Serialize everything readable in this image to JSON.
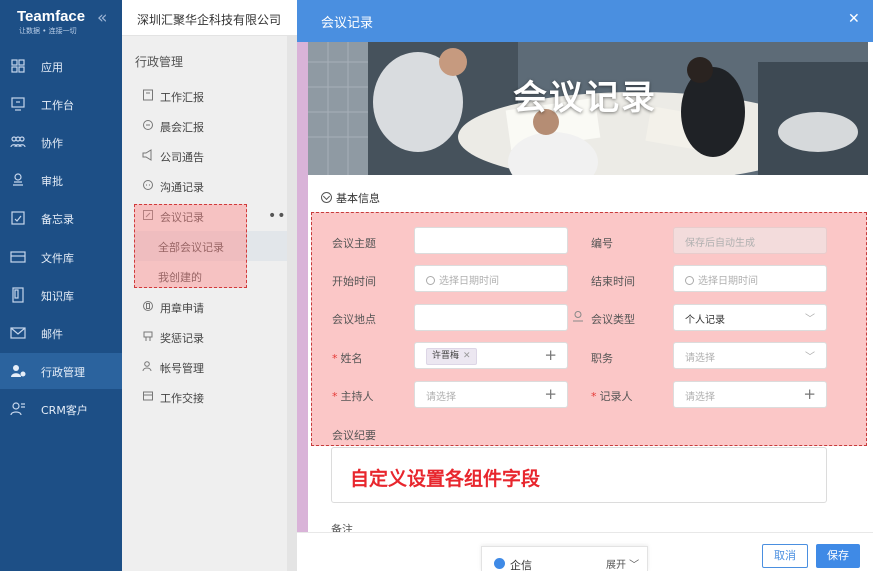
{
  "brand": {
    "name": "Teamface",
    "slogan": "让数据 • 连接一切"
  },
  "nav": [
    {
      "label": "应用",
      "icon": "apps-icon"
    },
    {
      "label": "工作台",
      "icon": "workbench-icon"
    },
    {
      "label": "协作",
      "icon": "collaboration-icon"
    },
    {
      "label": "审批",
      "icon": "approval-icon"
    },
    {
      "label": "备忘录",
      "icon": "memo-icon"
    },
    {
      "label": "文件库",
      "icon": "folder-icon"
    },
    {
      "label": "知识库",
      "icon": "knowledge-icon"
    },
    {
      "label": "邮件",
      "icon": "mail-icon"
    },
    {
      "label": "行政管理",
      "icon": "admin-icon"
    },
    {
      "label": "CRM客户",
      "icon": "crm-icon"
    }
  ],
  "menu": {
    "company": "深圳汇聚华企科技有限公司",
    "title": "行政管理",
    "items": [
      {
        "label": "工作汇报",
        "icon": "report-icon"
      },
      {
        "label": "晨会汇报",
        "icon": "meeting-report-icon"
      },
      {
        "label": "公司通告",
        "icon": "announcement-icon"
      },
      {
        "label": "沟通记录",
        "icon": "communication-icon"
      },
      {
        "label": "会议记录",
        "icon": "meeting-record-icon"
      },
      {
        "label": "用章申请",
        "icon": "seal-icon"
      },
      {
        "label": "奖惩记录",
        "icon": "reward-icon"
      },
      {
        "label": "帐号管理",
        "icon": "account-icon"
      },
      {
        "label": "工作交接",
        "icon": "handover-icon"
      }
    ],
    "subitems": [
      {
        "label": "全部会议记录"
      },
      {
        "label": "我创建的"
      }
    ]
  },
  "modal": {
    "title": "会议记录",
    "banner_text": "会议记录",
    "section": "基本信息",
    "fields": {
      "topic": {
        "label": "会议主题",
        "value": ""
      },
      "number": {
        "label": "编号",
        "placeholder": "保存后自动生成"
      },
      "start": {
        "label": "开始时间",
        "placeholder": "选择日期时间"
      },
      "end": {
        "label": "结束时间",
        "placeholder": "选择日期时间"
      },
      "location": {
        "label": "会议地点",
        "value": ""
      },
      "type": {
        "label": "会议类型",
        "value": "个人记录"
      },
      "name": {
        "label": "姓名",
        "tag": "许晋梅"
      },
      "position": {
        "label": "职务",
        "placeholder": "请选择"
      },
      "host": {
        "label": "主持人",
        "placeholder": "请选择"
      },
      "recorder": {
        "label": "记录人",
        "placeholder": "请选择"
      },
      "summary": {
        "label": "会议纪要",
        "text": "自定义设置各组件字段"
      },
      "remark": {
        "label": "备注"
      }
    },
    "cancel": "取消",
    "save": "保存"
  },
  "qixin": {
    "label": "企信",
    "expand": "展开"
  }
}
